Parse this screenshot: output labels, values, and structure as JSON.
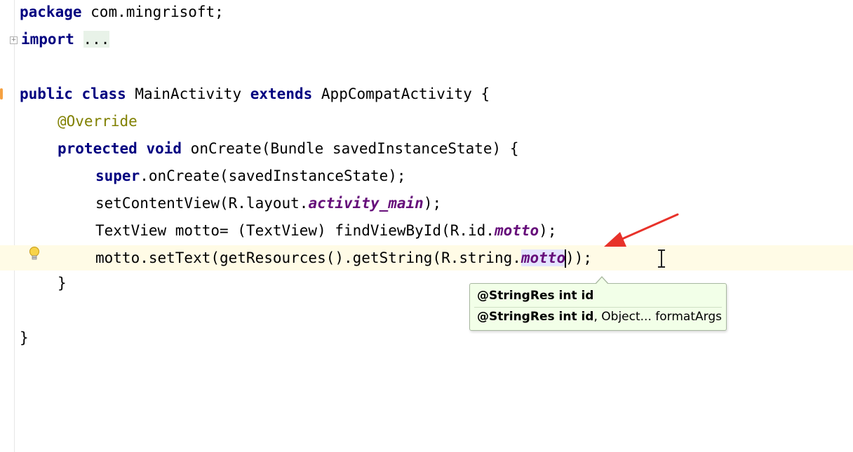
{
  "editor": {
    "line1": {
      "kw": "package",
      "rest": " com.mingrisoft;"
    },
    "line2": {
      "kw": "import",
      "sp": " ",
      "folded": "..."
    },
    "line3": {
      "kw1": "public",
      "sp1": " ",
      "kw2": "class",
      "mid": " MainActivity ",
      "kw3": "extends",
      "rest": " AppCompatActivity {"
    },
    "line4": {
      "anno": "@Override"
    },
    "line5": {
      "kw1": "protected",
      "sp1": " ",
      "kw2": "void",
      "rest": " onCreate(Bundle savedInstanceState) {"
    },
    "line6": {
      "kw": "super",
      "rest": ".onCreate(savedInstanceState);"
    },
    "line7": {
      "pre": "setContentView(R.layout.",
      "field": "activity_main",
      "post": ");"
    },
    "line8": {
      "pre": "TextView motto= (TextView) findViewById(R.id.",
      "field": "motto",
      "post": ");"
    },
    "line9": {
      "pre": "motto.setText(getResources().getString(R.string.",
      "field": "motto",
      "post": "));"
    },
    "line10": {
      "text": "}"
    },
    "line11": {
      "text": "}"
    }
  },
  "param_popup": {
    "row1_bold": "@StringRes int id",
    "row2_bold": "@StringRes int id",
    "row2_rest": ", Object... formatArgs"
  },
  "colors": {
    "keyword": "#000080",
    "annotation": "#808000",
    "field": "#660e7a",
    "popup_bg": "#f2ffe8",
    "arrow": "#e8322a"
  },
  "icons": [
    "fold-expand-icon",
    "fold-collapse-icon",
    "intention-bulb-icon",
    "text-cursor-icon",
    "red-arrow-annotation"
  ]
}
